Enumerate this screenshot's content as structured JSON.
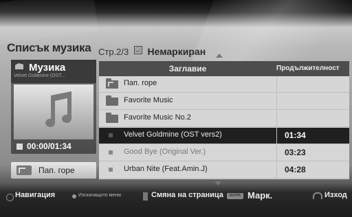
{
  "header": {
    "title": "Списък музика",
    "page_info": "Стр.2/3",
    "unmarked": "Немаркиран"
  },
  "now_playing": {
    "label": "Музика",
    "subtitle": "Velvet Goldmine (OST...",
    "time": "00:00/01:34"
  },
  "parent_button": {
    "label": "Пап. горе"
  },
  "list": {
    "col_title": "Заглавие",
    "col_duration": "Продължителност",
    "rows": [
      {
        "type": "folder-up",
        "name": "Пап. горе",
        "duration": ""
      },
      {
        "type": "folder",
        "name": "Favorite Music",
        "duration": ""
      },
      {
        "type": "folder",
        "name": "Favorite Music No.2",
        "duration": ""
      },
      {
        "type": "file",
        "name": "Velvet Goldmine (OST vers2)",
        "duration": "01:34",
        "selected": true
      },
      {
        "type": "file",
        "name": "Good Bye (Original Ver.)",
        "duration": "03:23"
      },
      {
        "type": "file",
        "name": "Urban Nite (Feat.Amin.J)",
        "duration": "04:28"
      }
    ]
  },
  "bottom_bar": {
    "navigation": "Навигация",
    "pop_up_menu": "Изскачащото меню",
    "page_change": "Смяна на страница",
    "mark_key": "MARK",
    "mark": "Марк.",
    "exit": "Изход"
  }
}
